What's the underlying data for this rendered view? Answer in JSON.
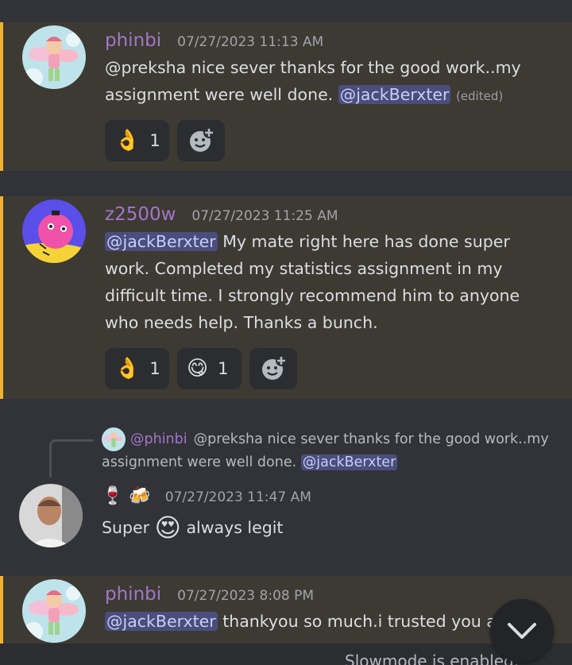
{
  "colors": {
    "background": "#313338",
    "highlight": "#3d3a34",
    "highlight_border": "#f0b232",
    "phinbi": "#a276c9",
    "z2500w": "#a276c9"
  },
  "messages": [
    {
      "username": "phinbi",
      "timestamp": "07/27/2023 11:13 AM",
      "text_before": "@preksha nice sever thanks for the good work..my assignment were well done.",
      "mention": "@jackBerxter",
      "edited": "(edited)",
      "reactions": [
        {
          "emoji": "👌",
          "count": "1"
        }
      ]
    },
    {
      "username": "z2500w",
      "timestamp": "07/27/2023 11:25 AM",
      "mention": "@jackBerxter",
      "text_after": "My mate right here has done super work. Completed my statistics assignment in my difficult time. I strongly recommend him to anyone who needs help. Thanks a bunch.",
      "reactions": [
        {
          "emoji": "👌",
          "count": "1"
        },
        {
          "emoji": "😋",
          "count": "1"
        }
      ]
    },
    {
      "reply": {
        "username": "@phinbi",
        "text": "@preksha nice sever thanks for the good work..my assignment were well done.",
        "mention": "@jackBerxter"
      },
      "name_emojis": "🍷 🍻",
      "timestamp": "07/27/2023 11:47 AM",
      "text_before": "Super",
      "emoji": "😍",
      "text_after": "always legit"
    },
    {
      "username": "phinbi",
      "timestamp": "07/27/2023 8:08 PM",
      "mention": "@jackBerxter",
      "text_after": "thankyou so much.i trusted you and"
    }
  ],
  "footer": {
    "slowmode": "Slowmode is enabled."
  }
}
